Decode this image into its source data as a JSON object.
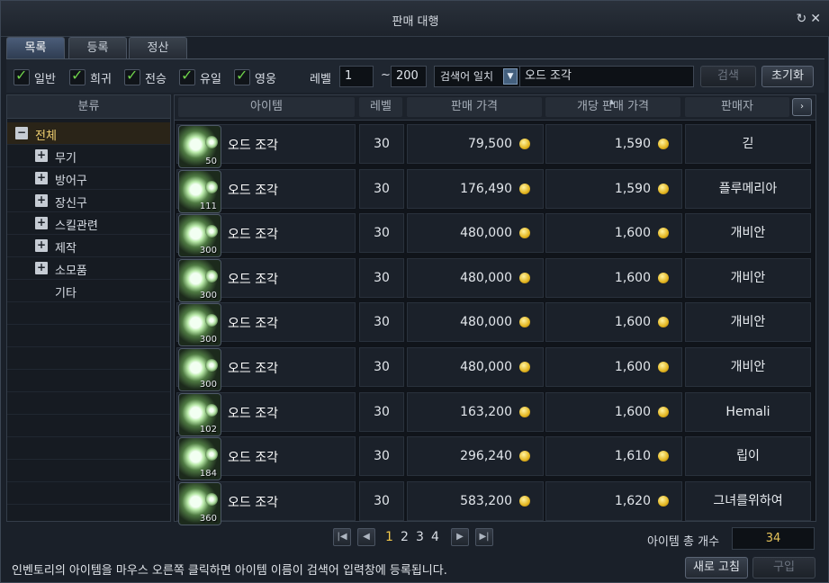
{
  "window": {
    "title": "판매 대행",
    "refresh_icon": "refresh-icon",
    "close_icon": "close-icon"
  },
  "tabs": [
    {
      "label": "목록",
      "active": true
    },
    {
      "label": "등록",
      "active": false
    },
    {
      "label": "정산",
      "active": false
    }
  ],
  "filters": {
    "grades": [
      {
        "label": "일반",
        "checked": true
      },
      {
        "label": "희귀",
        "checked": true
      },
      {
        "label": "전승",
        "checked": true
      },
      {
        "label": "유일",
        "checked": true
      },
      {
        "label": "영웅",
        "checked": true
      }
    ],
    "level_label": "레벨",
    "level_min": "1",
    "level_tilde": "~",
    "level_max": "200",
    "match_select": "검색어 일치",
    "search_value": "오드 조각",
    "search_button": "검색",
    "reset_button": "초기화"
  },
  "category": {
    "header": "분류",
    "items": [
      {
        "label": "전체",
        "expander": "−",
        "selected": true
      },
      {
        "label": "무기",
        "expander": "+"
      },
      {
        "label": "방어구",
        "expander": "+"
      },
      {
        "label": "장신구",
        "expander": "+"
      },
      {
        "label": "스킬관련",
        "expander": "+"
      },
      {
        "label": "제작",
        "expander": "+"
      },
      {
        "label": "소모품",
        "expander": "+"
      },
      {
        "label": "기타",
        "expander": ""
      }
    ]
  },
  "table": {
    "columns": {
      "item": "아이템",
      "level": "레벨",
      "price": "판매 가격",
      "unit_price": "개당 판매 가격",
      "seller": "판매자",
      "more": "›"
    },
    "rows": [
      {
        "icon": "od-fragment-icon",
        "qty": "50",
        "name": "오드 조각",
        "level": "30",
        "price": "79,500",
        "unit_price": "1,590",
        "seller": "긷"
      },
      {
        "icon": "od-fragment-icon",
        "qty": "111",
        "name": "오드 조각",
        "level": "30",
        "price": "176,490",
        "unit_price": "1,590",
        "seller": "플루메리아"
      },
      {
        "icon": "od-fragment-icon",
        "qty": "300",
        "name": "오드 조각",
        "level": "30",
        "price": "480,000",
        "unit_price": "1,600",
        "seller": "개비안"
      },
      {
        "icon": "od-fragment-icon",
        "qty": "300",
        "name": "오드 조각",
        "level": "30",
        "price": "480,000",
        "unit_price": "1,600",
        "seller": "개비안"
      },
      {
        "icon": "od-fragment-icon",
        "qty": "300",
        "name": "오드 조각",
        "level": "30",
        "price": "480,000",
        "unit_price": "1,600",
        "seller": "개비안"
      },
      {
        "icon": "od-fragment-icon",
        "qty": "300",
        "name": "오드 조각",
        "level": "30",
        "price": "480,000",
        "unit_price": "1,600",
        "seller": "개비안"
      },
      {
        "icon": "od-fragment-icon",
        "qty": "102",
        "name": "오드 조각",
        "level": "30",
        "price": "163,200",
        "unit_price": "1,600",
        "seller": "Hemali"
      },
      {
        "icon": "od-fragment-icon",
        "qty": "184",
        "name": "오드 조각",
        "level": "30",
        "price": "296,240",
        "unit_price": "1,610",
        "seller": "립이"
      },
      {
        "icon": "od-fragment-icon",
        "qty": "360",
        "name": "오드 조각",
        "level": "30",
        "price": "583,200",
        "unit_price": "1,620",
        "seller": "그녀를위하여"
      }
    ]
  },
  "pagination": {
    "first": "|◀",
    "prev": "◀",
    "pages": [
      "1",
      "2",
      "3",
      "4"
    ],
    "current": "1",
    "next": "▶",
    "last": "▶|"
  },
  "footer": {
    "total_label": "아이템 총 개수",
    "total_value": "34",
    "hint": "인벤토리의 아이템을 마우스 오른쪽 클릭하면 아이템 이름이 검색어 입력창에 등록됩니다.",
    "refresh_button": "새로 고침",
    "buy_button": "구입"
  },
  "colors": {
    "accent_gold": "#f1c84b",
    "check_green": "#6fd14a",
    "selected_category": "#f0d070"
  }
}
